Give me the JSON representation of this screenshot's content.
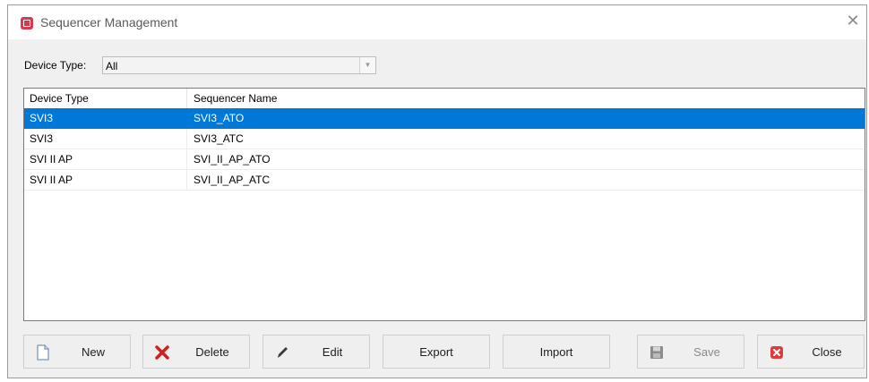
{
  "window": {
    "title": "Sequencer Management",
    "close_glyph": "✕"
  },
  "filter": {
    "label": "Device Type:",
    "value": "All"
  },
  "table": {
    "columns": [
      "Device Type",
      "Sequencer Name"
    ],
    "rows": [
      {
        "device_type": "SVI3",
        "sequencer_name": "SVI3_ATO",
        "selected": true
      },
      {
        "device_type": "SVI3",
        "sequencer_name": "SVI3_ATC",
        "selected": false
      },
      {
        "device_type": "SVI II AP",
        "sequencer_name": "SVI_II_AP_ATO",
        "selected": false
      },
      {
        "device_type": "SVI II AP",
        "sequencer_name": "SVI_II_AP_ATC",
        "selected": false
      }
    ]
  },
  "buttons": {
    "new": {
      "label": "New",
      "icon": "new-document-icon"
    },
    "delete": {
      "label": "Delete",
      "icon": "delete-x-icon"
    },
    "edit": {
      "label": "Edit",
      "icon": "pencil-icon"
    },
    "export": {
      "label": "Export"
    },
    "import": {
      "label": "Import"
    },
    "save": {
      "label": "Save",
      "icon": "floppy-disk-icon",
      "enabled": false
    },
    "close": {
      "label": "Close",
      "icon": "close-square-icon"
    }
  },
  "colors": {
    "selection": "#0078d7",
    "app_icon": "#d9394c",
    "delete_icon": "#d22020"
  }
}
